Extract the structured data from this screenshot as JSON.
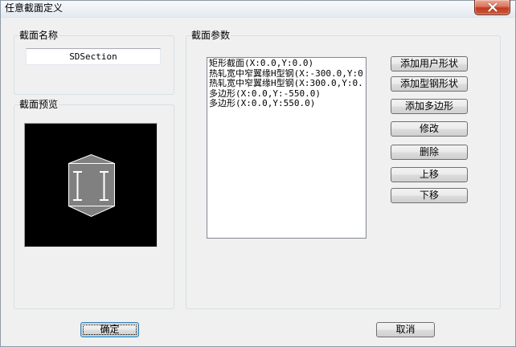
{
  "window": {
    "title": "任意截面定义",
    "close_icon": "close-icon"
  },
  "name_group": {
    "label": "截面名称",
    "section_name": "SDSection"
  },
  "preview_group": {
    "label": "截面预览"
  },
  "params_group": {
    "label": "截面参数",
    "items": [
      "矩形截面(X:0.0,Y:0.0)",
      "热轧宽中窄翼缘H型钢(X:-300.0,Y:0",
      "热轧宽中窄翼缘H型钢(X:300.0,Y:0.",
      "多边形(X:0.0,Y:-550.0)",
      "多边形(X:0.0,Y:550.0)"
    ],
    "buttons": {
      "add_user_shape": "添加用户形状",
      "add_steel_shape": "添加型钢形状",
      "add_polygon": "添加多边形",
      "modify": "修改",
      "delete": "删除",
      "move_up": "上移",
      "move_down": "下移"
    }
  },
  "footer": {
    "ok_label": "确定",
    "cancel_label": "取消"
  },
  "colors": {
    "dialog_background": "#f0f0f0",
    "preview_background": "#000000",
    "shape_fill": "#808080",
    "shape_outline": "#ffffff",
    "steel_fill": "#ffffff"
  }
}
